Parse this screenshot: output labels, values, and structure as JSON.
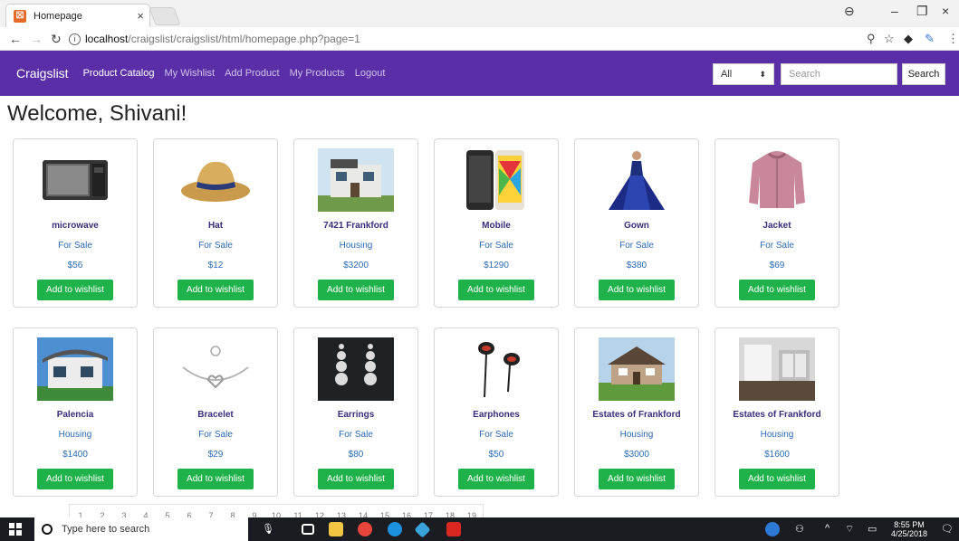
{
  "browser": {
    "tab_title": "Homepage",
    "favicon": "craigslist-favicon",
    "url_host": "localhost",
    "url_path": "/craigslist/craigslist/html/homepage.php?page=1"
  },
  "navbar": {
    "brand": "Craigslist",
    "links": [
      "Product Catalog",
      "My Wishlist",
      "Add Product",
      "My Products",
      "Logout"
    ],
    "category_selected": "All",
    "search_placeholder": "Search",
    "search_button": "Search",
    "color": "#5a2ea6"
  },
  "welcome": "Welcome, Shivani!",
  "products": [
    {
      "name": "microwave",
      "category": "For Sale",
      "price": "$56",
      "button": "Add to wishlist"
    },
    {
      "name": "Hat",
      "category": "For Sale",
      "price": "$12",
      "button": "Add to wishlist"
    },
    {
      "name": "7421 Frankford",
      "category": "Housing",
      "price": "$3200",
      "button": "Add to wishlist"
    },
    {
      "name": "Mobile",
      "category": "For Sale",
      "price": "$1290",
      "button": "Add to wishlist"
    },
    {
      "name": "Gown",
      "category": "For Sale",
      "price": "$380",
      "button": "Add to wishlist"
    },
    {
      "name": "Jacket",
      "category": "For Sale",
      "price": "$69",
      "button": "Add to wishlist"
    },
    {
      "name": "Palencia",
      "category": "Housing",
      "price": "$1400",
      "button": "Add to wishlist"
    },
    {
      "name": "Bracelet",
      "category": "For Sale",
      "price": "$29",
      "button": "Add to wishlist"
    },
    {
      "name": "Earrings",
      "category": "For Sale",
      "price": "$80",
      "button": "Add to wishlist"
    },
    {
      "name": "Earphones",
      "category": "For Sale",
      "price": "$50",
      "button": "Add to wishlist"
    },
    {
      "name": "Estates of Frankford",
      "category": "Housing",
      "price": "$3000",
      "button": "Add to wishlist"
    },
    {
      "name": "Estates of Frankford",
      "category": "Housing",
      "price": "$1600",
      "button": "Add to wishlist"
    }
  ],
  "pagination": [
    "1",
    "2",
    "3",
    "4",
    "5",
    "6",
    "7",
    "8",
    "9",
    "10",
    "11",
    "12",
    "13",
    "14",
    "15",
    "16",
    "17",
    "18",
    "19"
  ],
  "taskbar": {
    "search_placeholder": "Type here to search",
    "time": "8:55 PM",
    "date": "4/25/2018"
  },
  "colors": {
    "wishlist_button": "#20b24a",
    "product_name": "#3a2d7a",
    "product_meta": "#2c6bb5"
  }
}
